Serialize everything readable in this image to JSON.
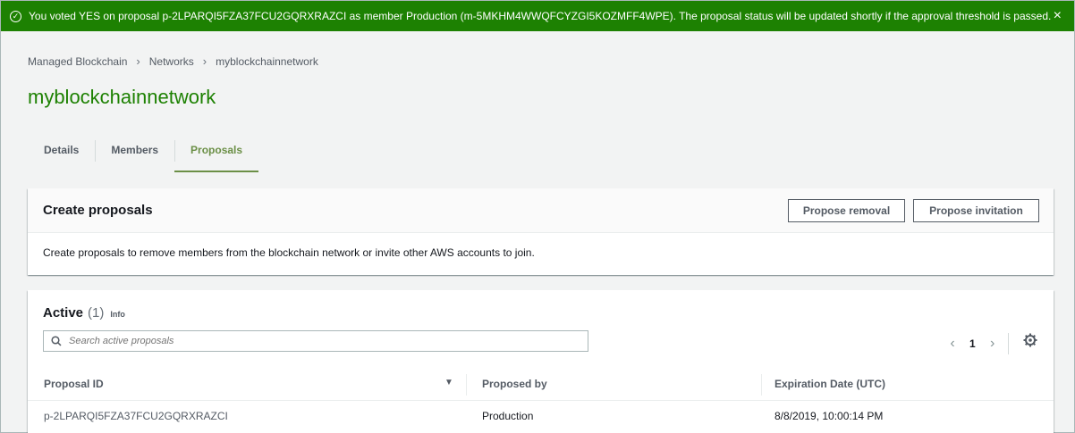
{
  "flash": {
    "message": "You voted YES on proposal p-2LPARQI5FZA37FCU2GQRXRAZCI as member Production (m-5MKHM4WWQFCYZGI5KOZMFF4WPE). The proposal status will be updated shortly if the approval threshold is passed.",
    "status_icon": "check-circle-icon",
    "close_label": "×"
  },
  "breadcrumb": {
    "items": [
      "Managed Blockchain",
      "Networks",
      "myblockchainnetwork"
    ],
    "separator": ">"
  },
  "page_title": "myblockchainnetwork",
  "tabs": {
    "details": "Details",
    "members": "Members",
    "proposals": "Proposals",
    "active": "Proposals"
  },
  "create_panel": {
    "title": "Create proposals",
    "propose_removal_label": "Propose removal",
    "propose_invitation_label": "Propose invitation",
    "description": "Create proposals to remove members from the blockchain network or invite other AWS accounts to join."
  },
  "active_panel": {
    "title": "Active",
    "count": "(1)",
    "info_label": "Info",
    "search_placeholder": "Search active proposals",
    "page": "1",
    "columns": [
      "Proposal ID",
      "Proposed by",
      "Expiration Date (UTC)"
    ],
    "rows": [
      {
        "proposal_id": "p-2LPARQI5FZA37FCU2GQRXRAZCI",
        "proposed_by": "Production",
        "expiration": "8/8/2019, 10:00:14 PM"
      }
    ]
  },
  "colors": {
    "success": "#1d8102",
    "tab_active": "#6b8f46",
    "text": "#16191f",
    "muted": "#545b64"
  }
}
